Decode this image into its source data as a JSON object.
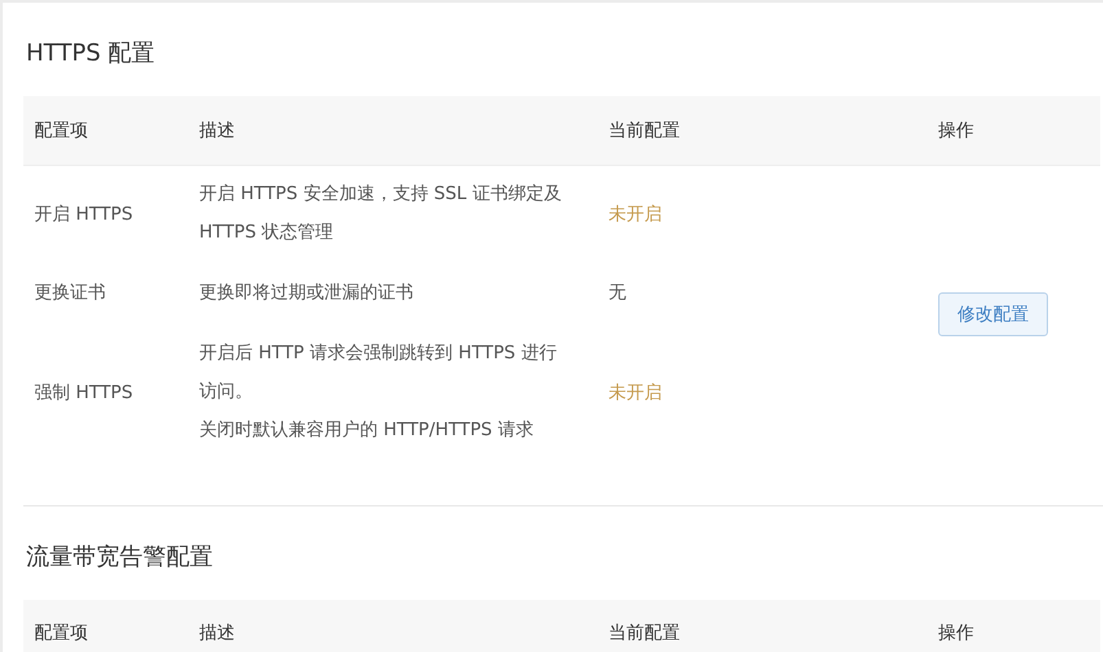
{
  "sections": [
    {
      "title": "HTTPS 配置",
      "columns": [
        "配置项",
        "描述",
        "当前配置",
        "操作"
      ],
      "rows": [
        {
          "item": "开启 HTTPS",
          "description": [
            "开启 HTTPS 安全加速，支持 SSL 证书绑定及",
            "HTTPS 状态管理"
          ],
          "current": "未开启",
          "kind": "warning"
        },
        {
          "item": "更换证书",
          "description": [
            "更换即将过期或泄漏的证书"
          ],
          "current": "无",
          "kind": "normal"
        },
        {
          "item": "强制 HTTPS",
          "description": [
            "开启后 HTTP 请求会强制跳转到 HTTPS 进行",
            "访问。",
            "关闭时默认兼容用户的 HTTP/HTTPS 请求"
          ],
          "current": "未开启",
          "kind": "warning"
        }
      ],
      "action": "修改配置"
    },
    {
      "title": "流量带宽告警配置",
      "columns": [
        "配置项",
        "描述",
        "当前配置",
        "操作"
      ]
    }
  ]
}
